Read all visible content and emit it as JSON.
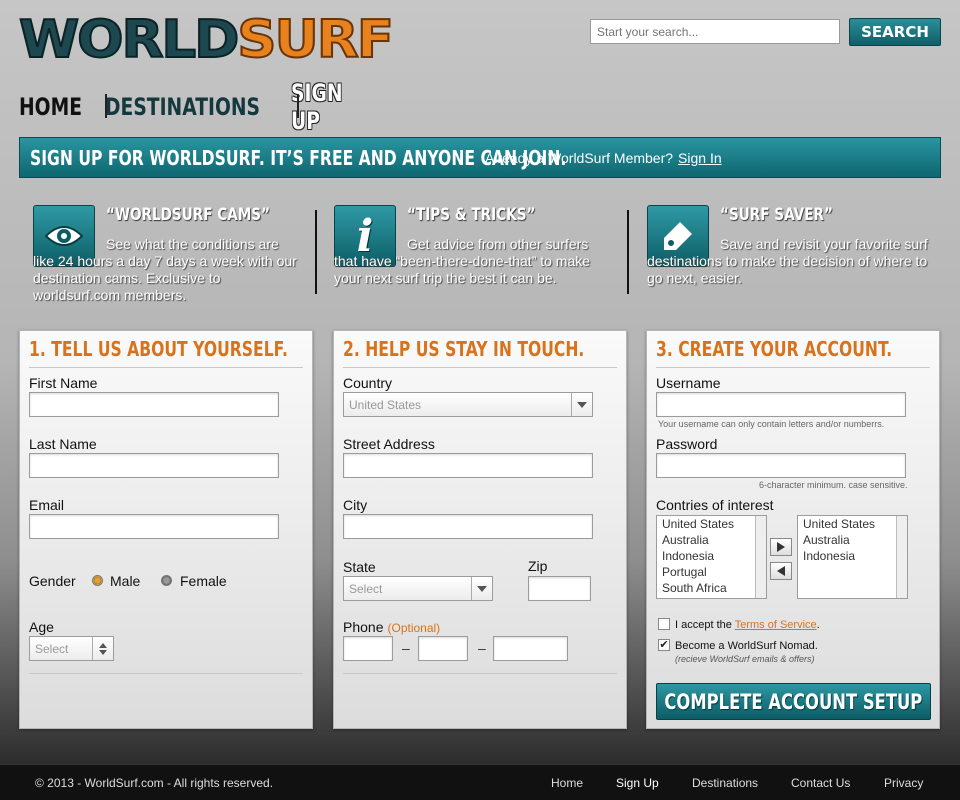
{
  "logo": {
    "part1": "WORLD",
    "part2": "SURF"
  },
  "search": {
    "placeholder": "Start your search...",
    "button_label": "SEARCH"
  },
  "nav": {
    "home": "HOME",
    "destinations": "DESTINATIONS",
    "signup": "SIGN UP"
  },
  "banner": {
    "title": "SIGN UP FOR WORLDSURF. IT’S FREE AND ANYONE CAN JOIN.",
    "question": "Already a WorldSurf Member?",
    "link": "Sign In"
  },
  "features": [
    {
      "icon": "eye-icon",
      "title": "“WORLDSURF CAMS”",
      "desc": "See what the conditions are like 24 hours a day 7 days a week with our destination cams. Exclusive to worldsurf.com members."
    },
    {
      "icon": "info-icon",
      "title": "“TIPS & TRICKS”",
      "desc": "Get advice from other surfers that have “been-there-done-that” to make your next surf trip the best it can be."
    },
    {
      "icon": "tag-icon",
      "title": "“SURF SAVER”",
      "desc": "Save and revisit your favorite surf destinations to make the decision of where to go next, easier."
    }
  ],
  "panel1": {
    "title": "1. TELL US ABOUT YOURSELF.",
    "first_name": "First Name",
    "last_name": "Last Name",
    "email": "Email",
    "gender": "Gender",
    "male": "Male",
    "female": "Female",
    "age": "Age",
    "age_select": "Select",
    "gender_selected": "Male"
  },
  "panel2": {
    "title": "2. HELP US STAY IN TOUCH.",
    "country": "Country",
    "country_value": "United States",
    "street": "Street Address",
    "city": "City",
    "state": "State",
    "state_select": "Select",
    "zip": "Zip",
    "phone": "Phone",
    "optional": "(Optional)",
    "dash": "–"
  },
  "panel3": {
    "title": "3. CREATE YOUR ACCOUNT.",
    "username": "Username",
    "username_hint": "Your username can only contain letters and/or numberrs.",
    "password": "Password",
    "password_hint": "6-character minimum. case sensitive.",
    "countries_label": "Contries of interest",
    "available": [
      "United States",
      "Australia",
      "Indonesia",
      "Portugal",
      "South Africa"
    ],
    "selected": [
      "United States",
      "Australia",
      "Indonesia"
    ],
    "accept_pre": "I accept the",
    "tos": "Terms of Service",
    "accept_post": ".",
    "accept_checked": false,
    "nomad": "Become a WorldSurf Nomad.",
    "nomad_checked": true,
    "nomad_note": "(recieve WorldSurf emails & offers)",
    "check_mark": "✔",
    "button": "COMPLETE ACCOUNT SETUP"
  },
  "footer": {
    "copyright": "© 2013 - WorldSurf.com - All rights reserved.",
    "links": [
      "Home",
      "Sign Up",
      "Destinations",
      "Contact Us",
      "Privacy"
    ]
  },
  "colors": {
    "teal": "#0e6670",
    "orange": "#d8731c",
    "logo_orange": "#e8821e"
  }
}
